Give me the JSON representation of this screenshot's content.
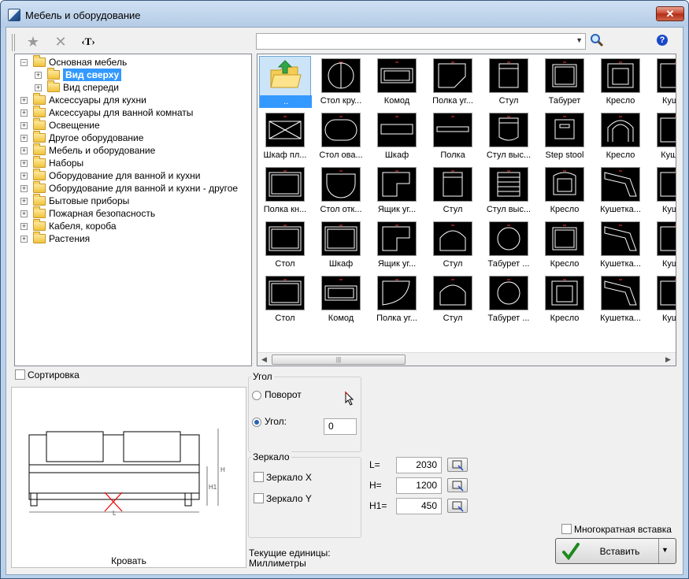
{
  "window": {
    "title": "Мебель и оборудование",
    "close": "✕"
  },
  "toolbar": {
    "text_tool": "‹T›",
    "search_value": ""
  },
  "tree": [
    {
      "label": "Основная мебель",
      "level": 0,
      "expander": "−"
    },
    {
      "label": "Вид сверху",
      "level": 1,
      "expander": "+",
      "selected": true
    },
    {
      "label": "Вид спереди",
      "level": 1,
      "expander": "+"
    },
    {
      "label": "Аксессуары для кухни",
      "level": 0,
      "expander": "+"
    },
    {
      "label": "Аксессуары для ванной комнаты",
      "level": 0,
      "expander": "+"
    },
    {
      "label": "Освещение",
      "level": 0,
      "expander": "+"
    },
    {
      "label": "Другое оборудование",
      "level": 0,
      "expander": "+"
    },
    {
      "label": "Мебель и оборудование",
      "level": 0,
      "expander": "+"
    },
    {
      "label": "Наборы",
      "level": 0,
      "expander": "+"
    },
    {
      "label": "Оборудование для ванной и кухни",
      "level": 0,
      "expander": "+"
    },
    {
      "label": "Оборудование для ванной и кухни - другое",
      "level": 0,
      "expander": "+"
    },
    {
      "label": "Бытовые приборы",
      "level": 0,
      "expander": "+"
    },
    {
      "label": "Пожарная безопасность",
      "level": 0,
      "expander": "+"
    },
    {
      "label": "Кабеля, короба",
      "level": 0,
      "expander": "+"
    },
    {
      "label": "Растения",
      "level": 0,
      "expander": "+"
    }
  ],
  "grid": {
    "rows": [
      [
        "..",
        "Стол кру...",
        "Комод",
        "Полка уг...",
        "Стул",
        "Табурет",
        "Кресло",
        "Куше..."
      ],
      [
        "Шкаф пл...",
        "Стол ова...",
        "Шкаф",
        "Полка",
        "Стул выс...",
        "Step stool",
        "Кресло",
        "Кушет..."
      ],
      [
        "Полка кн...",
        "Стол отк...",
        "Ящик уг...",
        "Стул",
        "Стул выс...",
        "Кресло",
        "Кушетка...",
        "Куше..."
      ],
      [
        "Стол",
        "Шкаф",
        "Ящик уг...",
        "Стул",
        "Табурет ...",
        "Кресло",
        "Кушетка...",
        "Куше..."
      ],
      [
        "Стол",
        "Комод",
        "Полка уг...",
        "Стул",
        "Табурет ...",
        "Кресло",
        "Кушетка...",
        "Куше..."
      ]
    ],
    "shapes": [
      [
        "folder",
        "circle",
        "rect-wide",
        "corner",
        "chair",
        "square",
        "armchair",
        "sofa"
      ],
      [
        "cross-rect",
        "oval",
        "bar",
        "bar-thin",
        "chair-high",
        "stool",
        "arch-chair",
        "sofa"
      ],
      [
        "rect",
        "half-circle",
        "l-shape",
        "chair",
        "lines",
        "armchair-round",
        "sofa-corner",
        "sofa"
      ],
      [
        "rect",
        "rect",
        "l-shape",
        "arch",
        "circle-small",
        "square",
        "sofa-corner",
        "sofa"
      ],
      [
        "rect",
        "rect-wide",
        "quarter",
        "arch",
        "circle-small",
        "armchair",
        "sofa-corner",
        "sofa"
      ]
    ]
  },
  "sort_label": "Сортировка",
  "preview_label": "Кровать",
  "preview_dims": {
    "L": "L",
    "H": "H",
    "H1": "H1"
  },
  "angle": {
    "title": "Угол",
    "rotate_label": "Поворот",
    "angle_label": "Угол:",
    "angle_value": "0"
  },
  "mirror": {
    "title": "Зеркало",
    "x_label": "Зеркало X",
    "y_label": "Зеркало Y"
  },
  "dims": [
    {
      "label": "L=",
      "value": "2030"
    },
    {
      "label": "H=",
      "value": "1200"
    },
    {
      "label": "H1=",
      "value": "450"
    }
  ],
  "units": {
    "line1": "Текущие единицы:",
    "line2": "Миллиметры"
  },
  "multi_insert_label": "Многократная вставка",
  "insert_label": "Вставить",
  "icons": [
    "star-icon",
    "delete-icon",
    "search-icon",
    "help-icon",
    "checkmark-icon"
  ]
}
